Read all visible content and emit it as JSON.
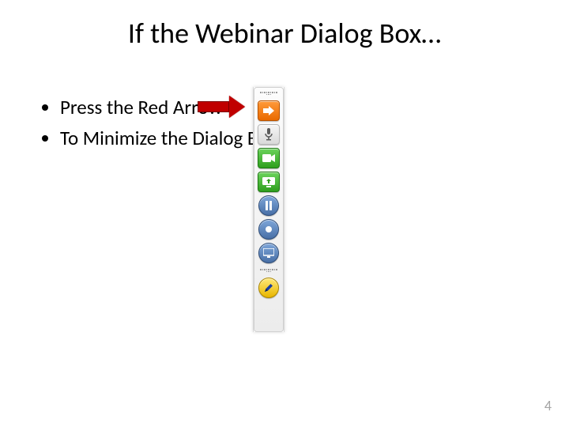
{
  "title": "If the Webinar Dialog Box…",
  "bullets": [
    "Press the Red Arrow",
    "To Minimize the Dialog Box"
  ],
  "pointer": {
    "color": "#c00000"
  },
  "toolbar": {
    "buttons": [
      {
        "name": "expand-arrow-button",
        "icon": "arrow-right-icon",
        "style": "orange",
        "interactable": true
      },
      {
        "name": "microphone-button",
        "icon": "microphone-icon",
        "style": "gray",
        "interactable": true
      },
      {
        "name": "webcam-button",
        "icon": "camera-icon",
        "style": "green",
        "interactable": true
      },
      {
        "name": "screen-share-button",
        "icon": "screen-icon",
        "style": "green",
        "interactable": true
      },
      {
        "name": "pause-button",
        "icon": "pause-icon",
        "style": "blue",
        "interactable": true
      },
      {
        "name": "record-button",
        "icon": "record-dot-icon",
        "style": "blue",
        "interactable": true
      },
      {
        "name": "monitor-button",
        "icon": "monitor-icon",
        "style": "blue",
        "interactable": true
      },
      {
        "name": "draw-tools-button",
        "icon": "pen-icon",
        "style": "yellow",
        "interactable": true
      }
    ]
  },
  "page_number": "4"
}
